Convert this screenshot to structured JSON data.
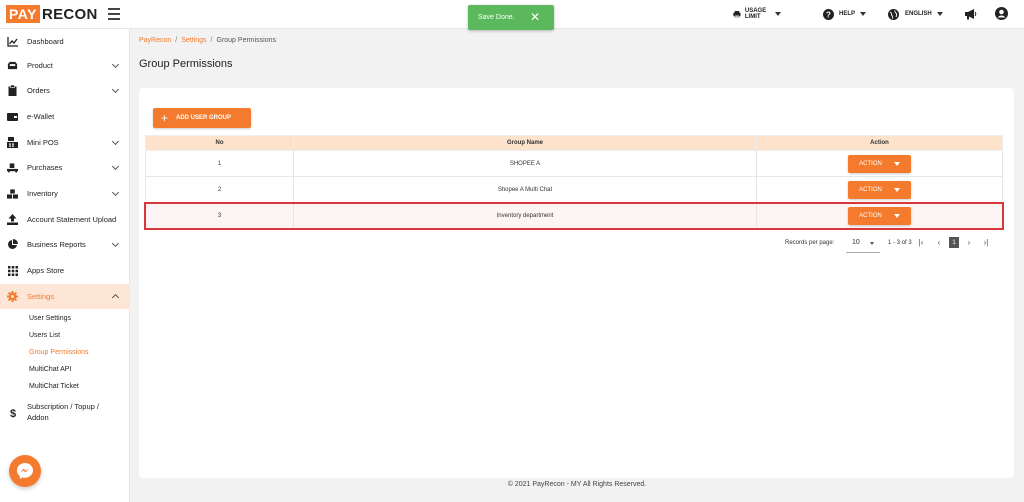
{
  "header": {
    "logo_left": "PAY",
    "logo_right": "RECON",
    "toast": {
      "message": "Save Done.",
      "close": "✕"
    },
    "usage_limit": "USAGE LIMIT",
    "help": "HELP",
    "language": "ENGLISH"
  },
  "sidebar": {
    "items": [
      {
        "label": "Dashboard",
        "icon": "chart-icon"
      },
      {
        "label": "Product",
        "icon": "box-icon"
      },
      {
        "label": "Orders",
        "icon": "clipboard-icon"
      },
      {
        "label": "e-Wallet",
        "icon": "wallet-icon"
      },
      {
        "label": "Mini POS",
        "icon": "pos-icon"
      },
      {
        "label": "Purchases",
        "icon": "truck-icon"
      },
      {
        "label": "Inventory",
        "icon": "boxes-icon"
      },
      {
        "label": "Account Statement Upload",
        "icon": "upload-icon"
      },
      {
        "label": "Business Reports",
        "icon": "pie-chart-icon"
      },
      {
        "label": "Apps Store",
        "icon": "grid-icon"
      },
      {
        "label": "Settings",
        "icon": "gear-icon"
      }
    ],
    "settings_sub": [
      "User Settings",
      "Users List",
      "Group Permissions",
      "MultiChat API",
      "MultiChat Ticket"
    ],
    "subscription_line1": "Subscription / Topup /",
    "subscription_line2": "Addon"
  },
  "breadcrumb": {
    "root": "PayRecon",
    "settings": "Settings",
    "current": "Group Permissions",
    "sep": "/"
  },
  "page": {
    "title": "Group Permissions",
    "add_button": "ADD USER GROUP",
    "add_icon": "+"
  },
  "table": {
    "headers": [
      "No",
      "Group Name",
      "Action"
    ],
    "rows": [
      {
        "no": "1",
        "name": "SHOPEE A",
        "action": "ACTION"
      },
      {
        "no": "2",
        "name": "Shopee A Multi Chat",
        "action": "ACTION"
      },
      {
        "no": "3",
        "name": "Inventory department",
        "action": "ACTION"
      }
    ]
  },
  "pagination": {
    "records_label": "Records per page:",
    "per_page": "10",
    "range": "1 - 3 of 3",
    "current_page": "1",
    "first": "|‹",
    "prev": "‹",
    "next": "›",
    "last": "›|"
  },
  "footer": {
    "text": "© 2021 PayRecon - MY All Rights Reserved."
  },
  "colors": {
    "brand": "#f47a2d",
    "toast": "#5cb85c",
    "highlight_border": "#d9363e"
  }
}
